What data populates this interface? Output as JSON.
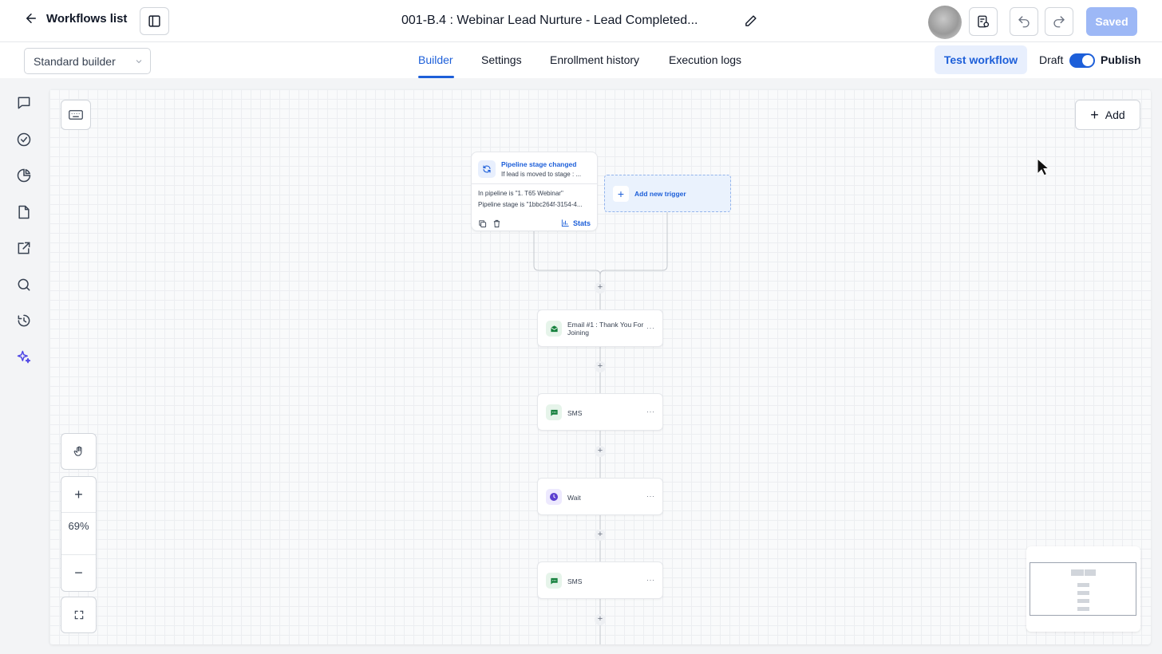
{
  "header": {
    "back_label": "Workflows list",
    "workflow_title": "001-B.4 : Webinar Lead Nurture - Lead Completed...",
    "saved_label": "Saved"
  },
  "subbar": {
    "builder_select_value": "Standard builder",
    "tabs": [
      {
        "label": "Builder",
        "active": true
      },
      {
        "label": "Settings",
        "active": false
      },
      {
        "label": "Enrollment history",
        "active": false
      },
      {
        "label": "Execution logs",
        "active": false
      }
    ],
    "test_workflow_label": "Test workflow",
    "draft_label": "Draft",
    "publish_label": "Publish",
    "publish_toggle_on": true
  },
  "rail": {
    "icons": [
      "chat-icon",
      "check-circle-icon",
      "pie-chart-icon",
      "document-icon",
      "external-link-icon",
      "search-icon",
      "history-icon",
      "sparkle-icon"
    ]
  },
  "canvas": {
    "add_label": "Add",
    "trigger": {
      "title": "Pipeline stage changed",
      "subtitle": "If lead is moved to stage : ...",
      "condition_1": "In pipeline is \"1. T65 Webinar\"",
      "condition_2": "Pipeline stage is \"1bbc264f-3154-4...",
      "stats_label": "Stats"
    },
    "add_trigger_label": "Add new trigger",
    "actions": [
      {
        "label": "Email #1 : Thank You For Joining",
        "type": "email"
      },
      {
        "label": "SMS",
        "type": "sms"
      },
      {
        "label": "Wait",
        "type": "wait"
      },
      {
        "label": "SMS",
        "type": "sms"
      }
    ],
    "zoom_level": "69%"
  },
  "colors": {
    "accent": "#1d5fd9",
    "saved_button": "#9db8f6",
    "sms_icon": "#15803d",
    "wait_icon": "#5b3fd0"
  }
}
